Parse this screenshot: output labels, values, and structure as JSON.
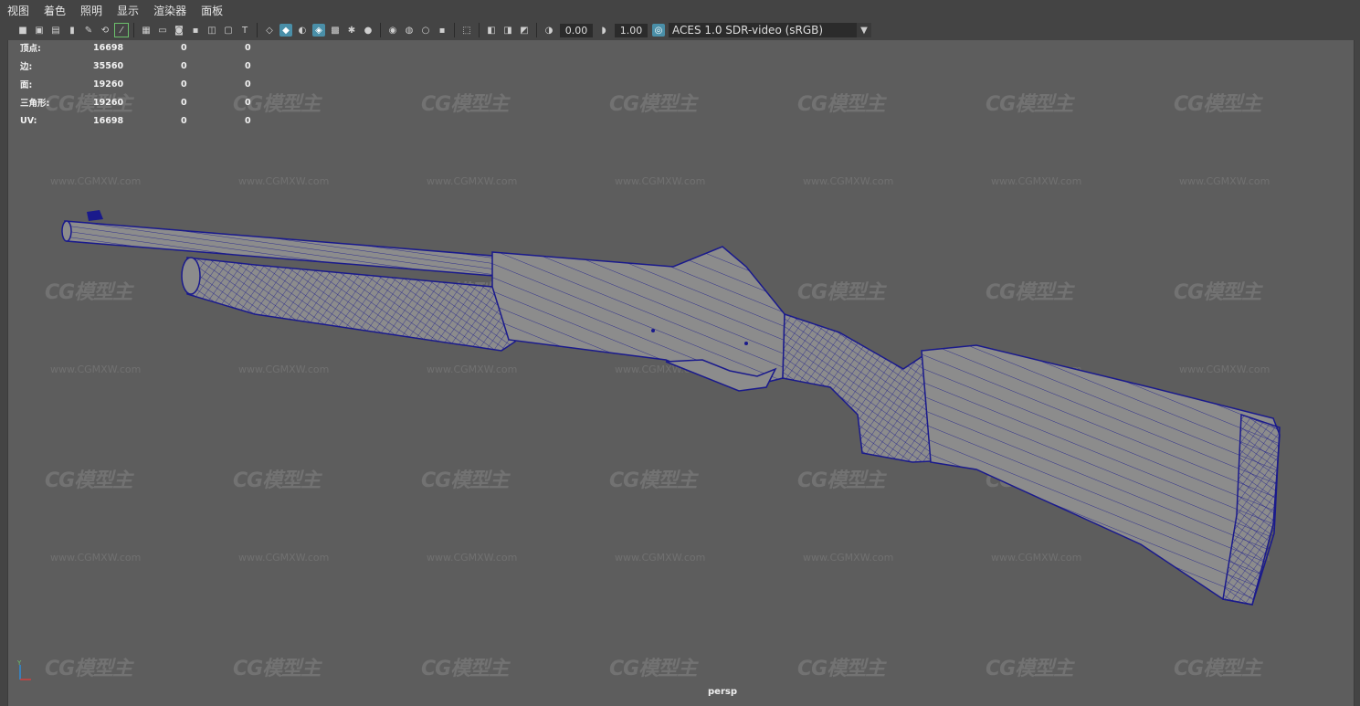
{
  "menu": [
    "视图",
    "着色",
    "照明",
    "显示",
    "渲染器",
    "面板"
  ],
  "toolbar": {
    "exposure": "0.00",
    "gamma": "1.00",
    "color_space": "ACES 1.0 SDR-video (sRGB)"
  },
  "hud": [
    {
      "label": "顶点:",
      "v1": "16698",
      "v2": "0",
      "v3": "0"
    },
    {
      "label": "边:",
      "v1": "35560",
      "v2": "0",
      "v3": "0"
    },
    {
      "label": "面:",
      "v1": "19260",
      "v2": "0",
      "v3": "0"
    },
    {
      "label": "三角形:",
      "v1": "19260",
      "v2": "0",
      "v3": "0"
    },
    {
      "label": "UV:",
      "v1": "16698",
      "v2": "0",
      "v3": "0"
    }
  ],
  "camera": "persp",
  "watermark": {
    "logo": "CG模型主",
    "site": "www.CGMXW.com"
  },
  "colors": {
    "wire": "#1a1a8c",
    "mesh": "#8c8c8c",
    "bg": "#5d5d5d",
    "accent": "#4a8fa8"
  }
}
